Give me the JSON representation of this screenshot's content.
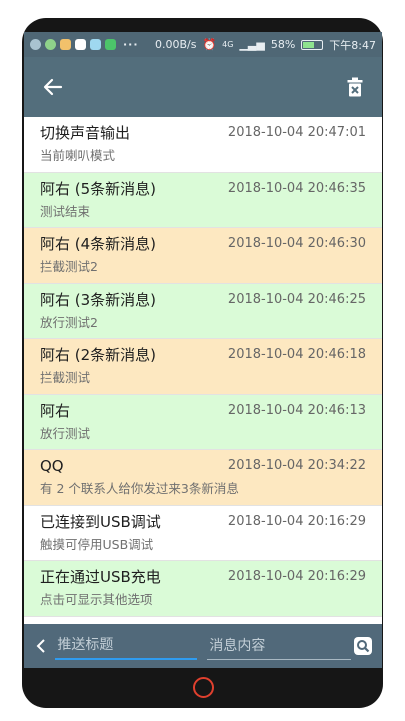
{
  "statusbar": {
    "net_speed": "0.00B/s",
    "signal": "4G",
    "battery": "58%",
    "battery_level": 0.58,
    "time": "下午8:47"
  },
  "toolbar": {
    "back_icon": "arrow-left-icon",
    "clear_icon": "delete-sweep-icon"
  },
  "notifications": [
    {
      "title": "切换声音输出",
      "time": "2018-10-04 20:47:01",
      "text": "当前喇叭模式",
      "color": "#ffffff"
    },
    {
      "title": "阿右 (5条新消息)",
      "time": "2018-10-04 20:46:35",
      "text": "测试结束",
      "color": "#dafbd7"
    },
    {
      "title": "阿右 (4条新消息)",
      "time": "2018-10-04 20:46:30",
      "text": "拦截测试2",
      "color": "#fde8c1"
    },
    {
      "title": "阿右 (3条新消息)",
      "time": "2018-10-04 20:46:25",
      "text": "放行测试2",
      "color": "#dafbd7"
    },
    {
      "title": "阿右 (2条新消息)",
      "time": "2018-10-04 20:46:18",
      "text": "拦截测试",
      "color": "#fde8c1"
    },
    {
      "title": "阿右",
      "time": "2018-10-04 20:46:13",
      "text": "放行测试",
      "color": "#dafbd7"
    },
    {
      "title": "QQ",
      "time": "2018-10-04 20:34:22",
      "text": "有 2 个联系人给你发过来3条新消息",
      "color": "#fde8c1"
    },
    {
      "title": "已连接到USB调试",
      "time": "2018-10-04 20:16:29",
      "text": "触摸可停用USB调试",
      "color": "#ffffff"
    },
    {
      "title": "正在通过USB充电",
      "time": "2018-10-04 20:16:29",
      "text": "点击可显示其他选项",
      "color": "#dafbd7"
    }
  ],
  "bottombar": {
    "title_placeholder": "推送标题",
    "content_placeholder": "消息内容",
    "search_icon": "search-icon",
    "collapse_icon": "chevron-left-icon"
  },
  "colors": {
    "appbar": "#536e7c",
    "statusbar": "#4f6775",
    "green_row": "#dafbd7",
    "orange_row": "#fde8c1",
    "accent": "#2f9cf0"
  }
}
